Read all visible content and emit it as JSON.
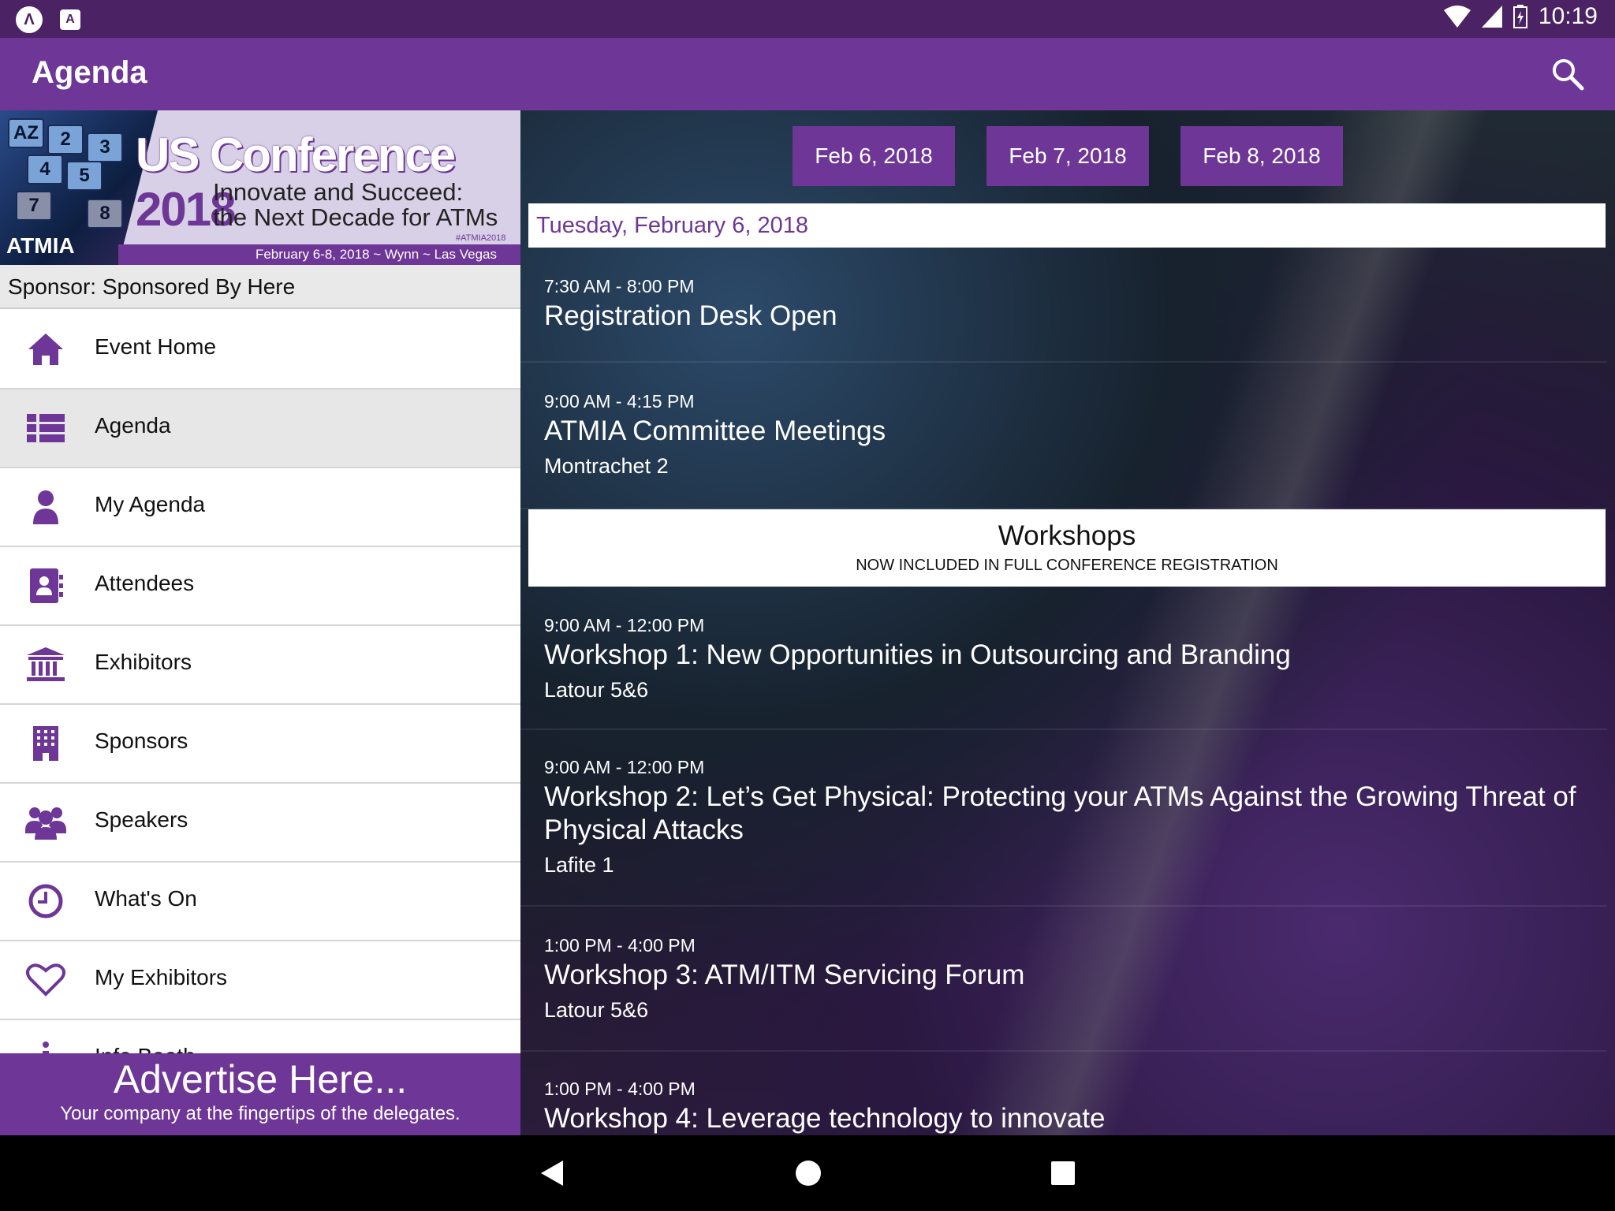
{
  "status_bar": {
    "time": "10:19"
  },
  "app_bar": {
    "title": "Agenda"
  },
  "banner": {
    "title": "US Conference",
    "year": "2018",
    "subtitle_line1": "Innovate and Succeed:",
    "subtitle_line2": "the Next Decade for ATMs",
    "hashtag": "#ATMIA2018",
    "dates_location": "February 6-8, 2018 ~ Wynn ~ Las Vegas",
    "org": "ATMIA"
  },
  "sponsor_text": "Sponsor: Sponsored By Here",
  "menu": [
    {
      "label": "Event Home",
      "icon": "home-icon"
    },
    {
      "label": "Agenda",
      "icon": "list-icon"
    },
    {
      "label": "My Agenda",
      "icon": "person-icon"
    },
    {
      "label": "Attendees",
      "icon": "contact-book-icon"
    },
    {
      "label": "Exhibitors",
      "icon": "institution-icon"
    },
    {
      "label": "Sponsors",
      "icon": "building-icon"
    },
    {
      "label": "Speakers",
      "icon": "group-icon"
    },
    {
      "label": "What's On",
      "icon": "clock-icon"
    },
    {
      "label": "My Exhibitors",
      "icon": "heart-icon"
    },
    {
      "label": "Info Booth",
      "icon": "info-icon"
    }
  ],
  "advert": {
    "headline": "Advertise Here...",
    "tagline": "Your company at the fingertips of the delegates."
  },
  "date_tabs": [
    "Feb 6, 2018",
    "Feb 7, 2018",
    "Feb 8, 2018"
  ],
  "day_header": "Tuesday, February 6, 2018",
  "sessions_before": [
    {
      "time": "7:30 AM - 8:00 PM",
      "title": "Registration Desk Open",
      "location": ""
    },
    {
      "time": "9:00 AM - 4:15 PM",
      "title": "ATMIA Committee Meetings",
      "location": "Montrachet 2"
    }
  ],
  "workshops_header": {
    "title": "Workshops",
    "subtitle": "NOW INCLUDED IN FULL CONFERENCE REGISTRATION"
  },
  "sessions_after": [
    {
      "time": "9:00 AM - 12:00 PM",
      "title": "Workshop 1: New Opportunities in Outsourcing and Branding",
      "location": "Latour 5&6"
    },
    {
      "time": "9:00 AM - 12:00 PM",
      "title": "Workshop 2: Let’s Get Physical: Protecting your ATMs Against the Growing Threat of Physical Attacks",
      "location": "Lafite 1"
    },
    {
      "time": "1:00 PM - 4:00 PM",
      "title": "Workshop 3: ATM/ITM Servicing Forum",
      "location": "Latour 5&6"
    },
    {
      "time": "1:00 PM - 4:00 PM",
      "title": "Workshop 4: Leverage technology to innovate",
      "location": ""
    }
  ]
}
